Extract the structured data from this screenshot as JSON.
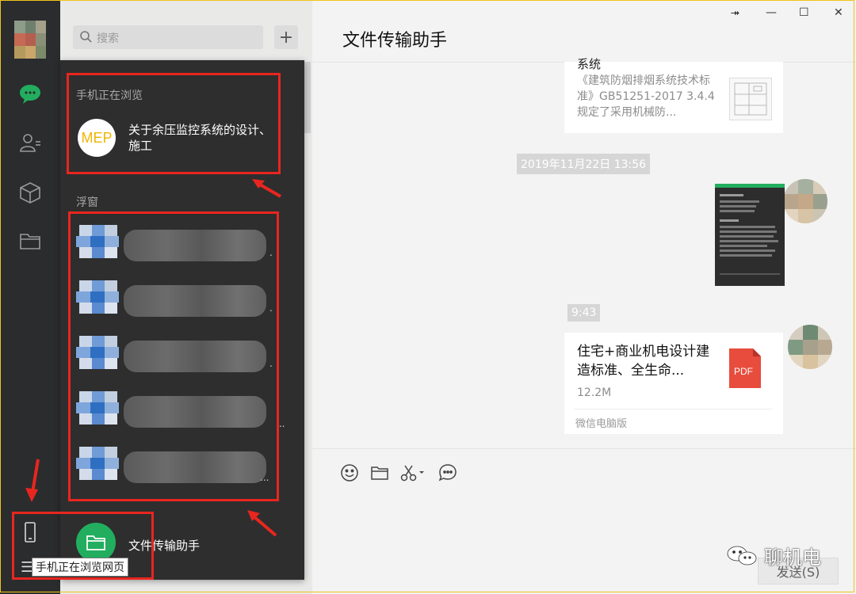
{
  "search": {
    "placeholder": "搜索"
  },
  "header": {
    "add_label": "+"
  },
  "flyout": {
    "browsing_heading": "手机正在浏览",
    "browsing_item": {
      "logo_text": "MEP",
      "title": "关于余压监控系统的设计、施工"
    },
    "floating_heading": "浮窗",
    "floating_items_ellipsis": [
      ".",
      ".",
      ".",
      "...",
      "..."
    ],
    "file_helper_label": "文件传输助手"
  },
  "phone_tooltip": "手机正在浏览网页",
  "hamburger": "☰",
  "chat": {
    "title": "文件传输助手",
    "window_controls": {
      "pin": "⯮",
      "minimize": "—",
      "maximize": "☐",
      "close": "✕"
    },
    "messages": {
      "article_partial_top": "系统",
      "article_excerpt": "《建筑防烟排烟系统技术标准》GB51251-2017 3.4.4规定了采用机械防...",
      "timestamp1": "2019年11月22日 13:56",
      "timestamp2": "9:43",
      "file": {
        "title": "住宅+商业机电设计建造标准、全生命...",
        "size": "12.2M",
        "source": "微信电脑版",
        "type_label": "PDF"
      }
    },
    "send_label": "发送(S)"
  },
  "watermark": "聊机电",
  "icons": [
    "search-icon",
    "chat-icon",
    "contacts-icon",
    "cube-icon",
    "folder-icon",
    "phone-icon",
    "emoji-icon",
    "file-icon",
    "scissors-icon",
    "bubble-icon"
  ],
  "colors": {
    "accent_green": "#22ae5e",
    "annotation_red": "#e8261f",
    "frame_yellow": "#f0c419"
  }
}
